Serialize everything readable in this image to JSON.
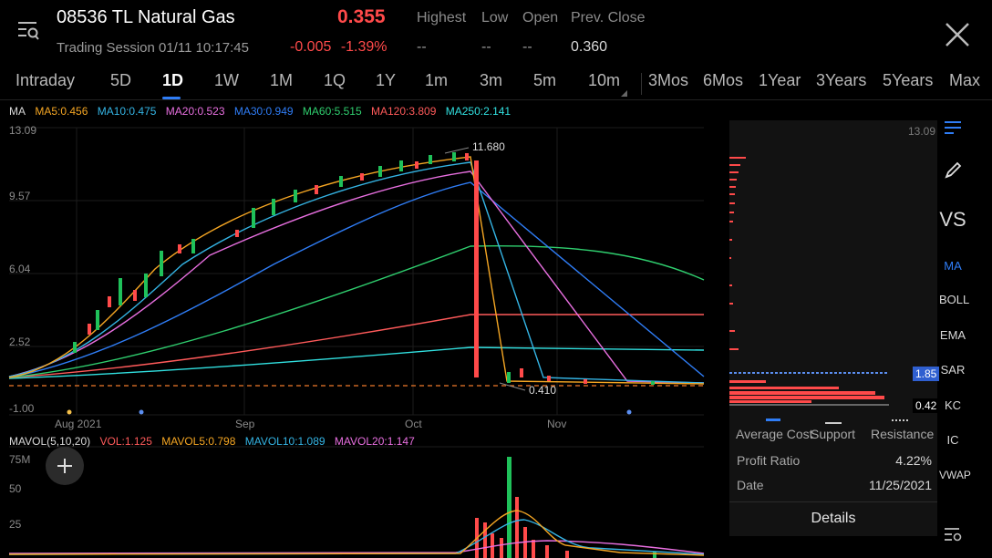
{
  "header": {
    "symbol": "08536 TL Natural Gas",
    "price": "0.355",
    "session": "Trading Session 01/11 10:17:45",
    "change": "-0.005",
    "change_pct": "-1.39%",
    "stats": [
      {
        "label": "Highest",
        "value": "--"
      },
      {
        "label": "Low",
        "value": "--"
      },
      {
        "label": "Open",
        "value": "--"
      },
      {
        "label": "Prev. Close",
        "value": "0.360"
      }
    ]
  },
  "tabs": [
    "Intraday",
    "5D",
    "1D",
    "1W",
    "1M",
    "1Q",
    "1Y",
    "1m",
    "3m",
    "5m",
    "10m",
    "3Mos",
    "6Mos",
    "1Year",
    "3Years",
    "5Years",
    "Max"
  ],
  "active_tab": "1D",
  "ma_legend": {
    "title": "MA",
    "items": [
      {
        "text": "MA5:0.456",
        "color": "#f5a623"
      },
      {
        "text": "MA10:0.475",
        "color": "#34b4e4"
      },
      {
        "text": "MA20:0.523",
        "color": "#e86fe0"
      },
      {
        "text": "MA30:0.949",
        "color": "#2f7df6"
      },
      {
        "text": "MA60:5.515",
        "color": "#2fce6e"
      },
      {
        "text": "MA120:3.809",
        "color": "#ff5a5a"
      },
      {
        "text": "MA250:2.141",
        "color": "#31e0e0"
      }
    ]
  },
  "price_axis": [
    "13.09",
    "9.57",
    "6.04",
    "2.52",
    "-1.00"
  ],
  "time_axis": [
    "Aug 2021",
    "Sep",
    "Oct",
    "Nov"
  ],
  "annotations": {
    "high": "11.680",
    "low": "0.410"
  },
  "side_panel": {
    "top_label": "13.09",
    "tag_avg": "1.85",
    "tag_last": "0.42",
    "legend": [
      "Average Cost",
      "Support",
      "Resistance"
    ],
    "rows": [
      {
        "label": "Profit Ratio",
        "value": "4.22%"
      },
      {
        "label": "Date",
        "value": "11/25/2021"
      }
    ],
    "details": "Details"
  },
  "toolbar": [
    "VS",
    "MA",
    "BOLL",
    "EMA",
    "SAR",
    "KC",
    "IC",
    "VWAP"
  ],
  "vol_legend": {
    "title": "MAVOL(5,10,20)",
    "items": [
      {
        "text": "VOL:1.125",
        "color": "#ff5a5a"
      },
      {
        "text": "MAVOL5:0.798",
        "color": "#f5a623"
      },
      {
        "text": "MAVOL10:1.089",
        "color": "#34b4e4"
      },
      {
        "text": "MAVOL20:1.147",
        "color": "#e86fe0"
      }
    ]
  },
  "vol_axis": [
    "75M",
    "50",
    "25"
  ],
  "colors": {
    "up": "#1fc15a",
    "down": "#ff4a4a",
    "accent": "#2f7df6"
  }
}
